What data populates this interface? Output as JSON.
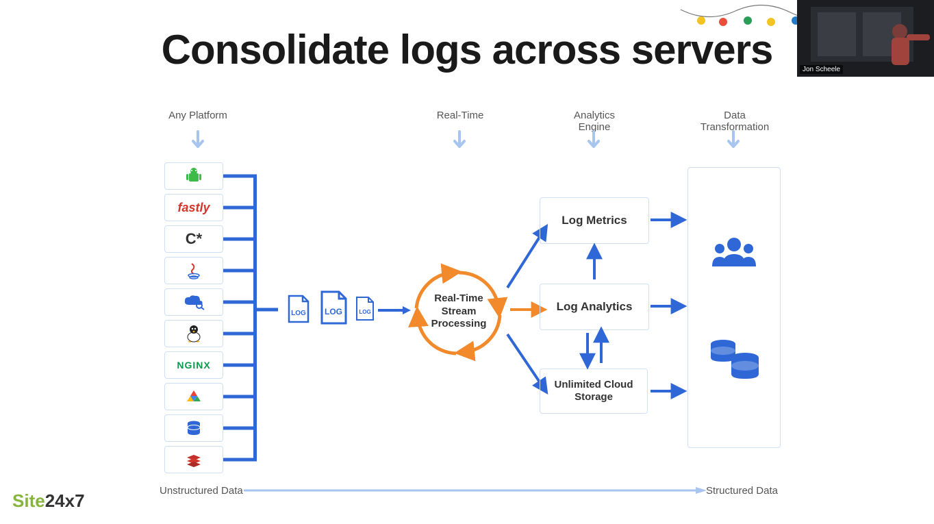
{
  "title": "Consolidate logs across servers",
  "columns": {
    "platform": "Any Platform",
    "realtime": "Real-Time",
    "analytics": "Analytics Engine",
    "transform": "Data Transformation"
  },
  "platforms": [
    {
      "name": "Android"
    },
    {
      "name": "fastly",
      "label": "fastly",
      "color": "#d4352a"
    },
    {
      "name": "Cassandra",
      "label": "C*",
      "color": "#333"
    },
    {
      "name": "Java"
    },
    {
      "name": "Cloud Search"
    },
    {
      "name": "Linux"
    },
    {
      "name": "nginx",
      "label": "NGINX",
      "color": "#0a9a4a"
    },
    {
      "name": "Google Cloud"
    },
    {
      "name": "Database"
    },
    {
      "name": "Redis"
    }
  ],
  "log_label": "LOG",
  "center_node": "Real-Time Stream Processing",
  "engine_nodes": {
    "metrics": "Log Metrics",
    "analytics": "Log Analytics",
    "storage": "Unlimited Cloud Storage"
  },
  "footer": {
    "left": "Unstructured Data",
    "right": "Structured Data"
  },
  "brand": {
    "part1": "Site",
    "part2": "24x7"
  },
  "webcam_name": "Jon Scheele",
  "colors": {
    "blue": "#2f68d6",
    "light_blue": "#a8c5ef",
    "orange": "#f2892b"
  }
}
